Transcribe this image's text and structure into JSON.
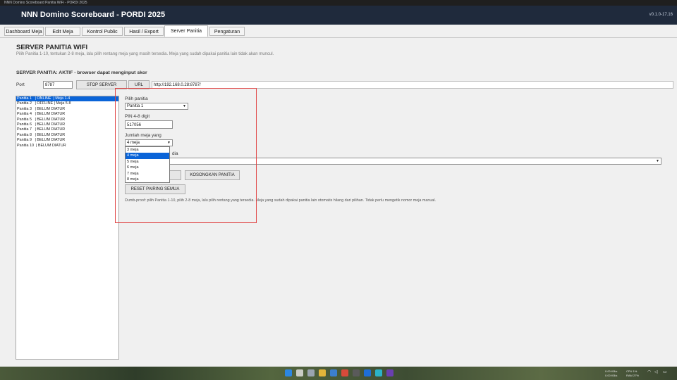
{
  "window": {
    "title": "NNN Domino Scoreboard Panitia WiFi - PORDI 2025"
  },
  "header": {
    "app_title": "NNN Domino Scoreboard - PORDI 2025",
    "version": "v0.1.0-17.16"
  },
  "tabs": [
    {
      "label": "Dashboard Meja"
    },
    {
      "label": "Edit Meja"
    },
    {
      "label": "Kontrol Public"
    },
    {
      "label": "Hasil / Export"
    },
    {
      "label": "Server Panitia",
      "active": true
    },
    {
      "label": "Pengaturan"
    }
  ],
  "section": {
    "title": "SERVER PANITIA WIFI",
    "description": "Pilih Panitia 1-10, tentukan 2-8 meja, lalu pilih rentang meja yang masih tersedia. Meja yang sudah dipakai panitia lain tidak akan muncul."
  },
  "server": {
    "status": "SERVER PANITIA: AKTIF - browser dapat menginput skor",
    "port_label": "Port",
    "port_value": "8787",
    "stop_button": "STOP SERVER",
    "url_button": "URL",
    "url_value": "http://192.168.0.28:8787/"
  },
  "panitia_list": [
    "Panitia 1   | ONLINE  | Meja 1-4",
    "Panitia 2   | OFFLINE | Meja 5-8",
    "Panitia 3   | BELUM DIATUR",
    "Panitia 4   | BELUM DIATUR",
    "Panitia 5   | BELUM DIATUR",
    "Panitia 6   | BELUM DIATUR",
    "Panitia 7   | BELUM DIATUR",
    "Panitia 8   | BELUM DIATUR",
    "Panitia 9   | BELUM DIATUR",
    "Panitia 10  | BELUM DIATUR"
  ],
  "form": {
    "pilih_label": "Pilih panitia",
    "pilih_value": "Panitia 1",
    "pin_label": "PIN 4-8 digit",
    "pin_value": "517056",
    "jumlah_label": "Jumlah meja yang",
    "jumlah_value": "4 meja",
    "jumlah_options": [
      "3 meja",
      "4 meja",
      "5 meja",
      "6 meja",
      "7 meja",
      "8 meja"
    ],
    "jumlah_highlighted": 1,
    "rentang_label_tail": "dia",
    "kosongkan_button": "KOSONGKAN PANITIA",
    "reset_button": "RESET PAIRING SEMUA",
    "hint": "Dumb-proof: pilih Panitia 1-10, pilih 2-8 meja, lalu pilih rentang yang tersedia. Meja yang sudah dipakai panitia lain otomatis hilang dari pilihan. Tidak perlu mengetik nomor meja manual."
  },
  "tray": {
    "upload": "0.00 KB/s",
    "download": "0.00 KB/s",
    "cpu": "CPU 1%",
    "ram": "RAM 27%"
  },
  "colors": {
    "header_bg": "#1f2a3c",
    "selection": "#0a64d8",
    "highlight_box": "#e04545"
  }
}
